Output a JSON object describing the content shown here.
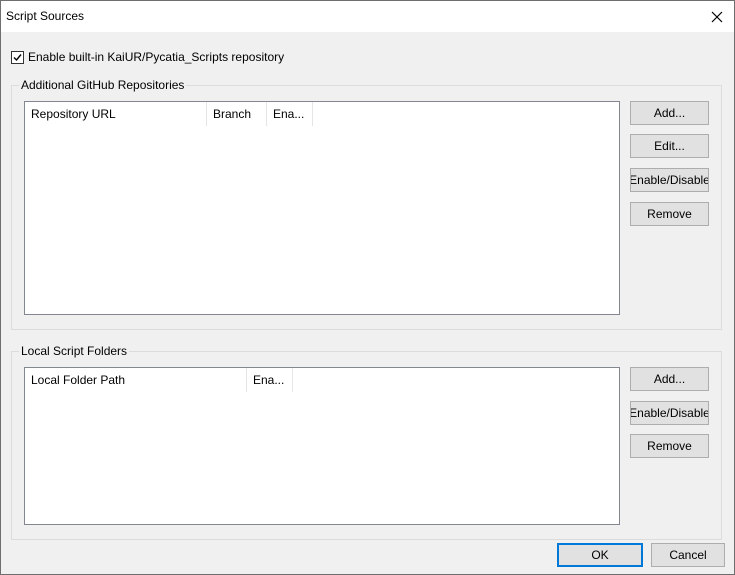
{
  "window": {
    "title": "Script Sources"
  },
  "builtin_repo": {
    "checked": true,
    "label": "Enable built-in KaiUR/Pycatia_Scripts repository"
  },
  "github_group": {
    "title": "Additional GitHub Repositories",
    "columns": [
      "Repository URL",
      "Branch",
      "Ena..."
    ],
    "rows": [],
    "buttons": {
      "add": "Add...",
      "edit": "Edit...",
      "toggle": "Enable/Disable",
      "remove": "Remove"
    }
  },
  "local_group": {
    "title": "Local Script Folders",
    "columns": [
      "Local Folder Path",
      "Ena..."
    ],
    "rows": [],
    "buttons": {
      "add": "Add...",
      "toggle": "Enable/Disable",
      "remove": "Remove"
    }
  },
  "footer": {
    "ok": "OK",
    "cancel": "Cancel"
  }
}
